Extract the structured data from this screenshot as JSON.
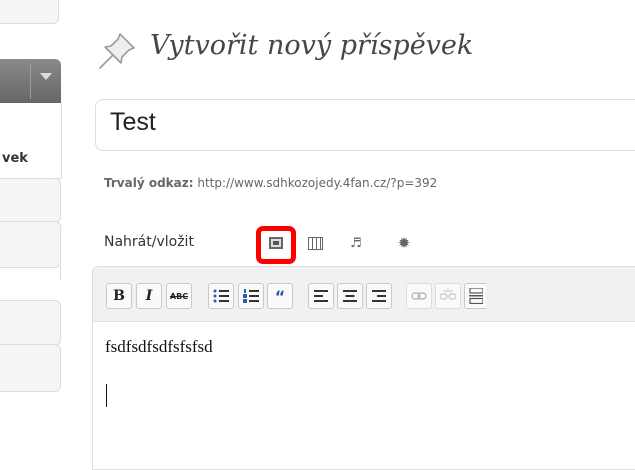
{
  "sidebar": {
    "active_item_label": "vek"
  },
  "header": {
    "icon": "pushpin-icon",
    "title": "Vytvořit nový příspěvek"
  },
  "post": {
    "title_value": "Test",
    "permalink_label": "Trvalý odkaz:",
    "permalink_url": "http://www.sdhkozojedy.4fan.cz/?p=392"
  },
  "media": {
    "label": "Nahrát/vložit",
    "buttons": [
      "image-icon",
      "video-icon",
      "audio-icon",
      "media-icon"
    ],
    "highlight_color": "#ff0000"
  },
  "editor": {
    "toolbar": [
      {
        "name": "bold-button",
        "label": "B"
      },
      {
        "name": "italic-button",
        "label": "I"
      },
      {
        "name": "strikethrough-button",
        "label": "ABC"
      },
      {
        "name": "bullet-list-button",
        "label": ""
      },
      {
        "name": "numbered-list-button",
        "label": ""
      },
      {
        "name": "blockquote-button",
        "label": "“"
      },
      {
        "name": "align-left-button",
        "label": ""
      },
      {
        "name": "align-center-button",
        "label": ""
      },
      {
        "name": "align-right-button",
        "label": ""
      },
      {
        "name": "insert-link-button",
        "label": ""
      },
      {
        "name": "unlink-button",
        "label": ""
      },
      {
        "name": "more-button",
        "label": ""
      }
    ],
    "content": "fsdfsdfsdfsfsfsd"
  }
}
